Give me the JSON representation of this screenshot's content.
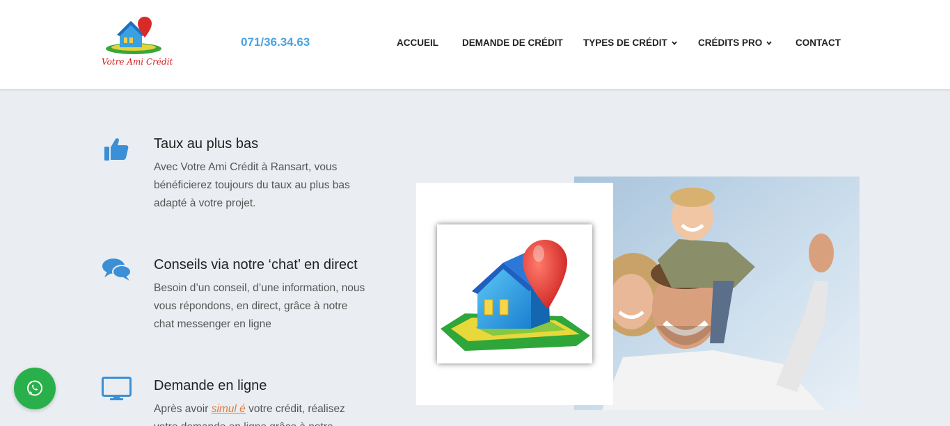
{
  "header": {
    "logo_text": "Votre Ami Crédit",
    "phone": "071/36.34.63",
    "nav": [
      {
        "label": "ACCUEIL",
        "has_dropdown": false
      },
      {
        "label": "DEMANDE DE CRÉDIT",
        "has_dropdown": false
      },
      {
        "label": "TYPES DE CRÉDIT",
        "has_dropdown": true
      },
      {
        "label": "CRÉDITS PRO",
        "has_dropdown": true
      },
      {
        "label": "CONTACT",
        "has_dropdown": false
      }
    ]
  },
  "features": [
    {
      "icon": "thumbs-up-icon",
      "title": "Taux au plus bas",
      "text": "Avec Votre Ami Crédit à Ransart, vous bénéficierez toujours du taux au plus bas adapté à votre projet."
    },
    {
      "icon": "chat-bubbles-icon",
      "title": "Conseils via notre ‘chat’ en direct",
      "text": "Besoin d’un conseil, d’une information, nous vous répondons, en direct, grâce à notre chat messenger en ligne"
    },
    {
      "icon": "monitor-icon",
      "title": "Demande en ligne",
      "text_before": "Après avoir ",
      "link": "simul é",
      "text_after": " votre crédit, réalisez votre demande en ligne grâce à notre"
    }
  ],
  "colors": {
    "accent": "#4aa3df",
    "background": "#eaeef2",
    "whatsapp": "#2ab04a",
    "link": "#e07b3a"
  }
}
